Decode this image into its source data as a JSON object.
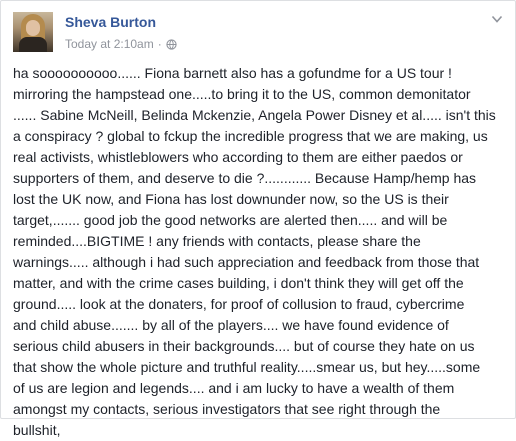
{
  "post": {
    "author": "Sheva Burton",
    "timestamp": "Today at 2:10am",
    "separator": "·",
    "privacy_icon": "globe-icon",
    "menu_icon": "chevron-down-icon",
    "text": "ha soooooooooo...... Fiona barnett also has a gofundme for a US tour !\nmirroring the hampstead one.....to bring it to the US, common demonitator\n...... Sabine McNeill, Belinda Mckenzie, Angela Power Disney et al..... isn't this\na conspiracy ? global to fckup the incredible progress that we are making, us\nreal activists, whistleblowers who according to them are either paedos or\nsupporters of them, and deserve to die ?............ Because Hamp/hemp has\nlost the UK now, and Fiona has lost downunder now, so the US is their\ntarget,....... good job the good networks are alerted then..... and will be\nreminded....BIGTIME ! any friends with contacts, please share the\nwarnings..... although i had such appreciation and feedback from those that\nmatter, and with the crime cases building, i don't think they will get off the\nground..... look at the donaters, for proof of collusion to fraud, cybercrime\nand child abuse....... by all of the players.... we have found evidence of\nserious child abusers in their backgrounds.... but of course they hate on us\nthat show the whole picture and truthful reality.....smear us, but hey.....some\nof us are legion and legends.... and i am lucky to have a wealth of them\namongst my contacts, serious investigators that see right through the\nbullshit,"
  },
  "colors": {
    "name": "#365899",
    "meta": "#90949c",
    "text": "#1d2129",
    "border": "#dddfe2"
  }
}
